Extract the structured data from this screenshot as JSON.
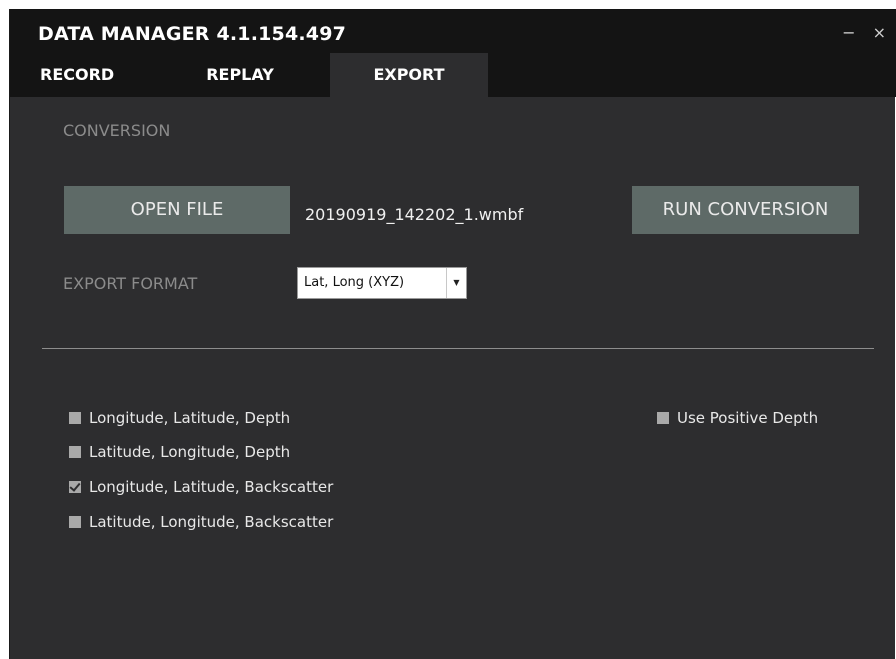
{
  "window": {
    "title": "DATA MANAGER  4.1.154.497",
    "minimize_glyph": "−",
    "close_glyph": "×"
  },
  "tabs": [
    {
      "label": "RECORD",
      "active": false
    },
    {
      "label": "REPLAY",
      "active": false
    },
    {
      "label": "EXPORT",
      "active": true
    }
  ],
  "conversion": {
    "section_title": "CONVERSION",
    "open_file_label": "OPEN FILE",
    "file_name": "20190919_142202_1.wmbf",
    "run_conversion_label": "RUN CONVERSION"
  },
  "export_format": {
    "label": "EXPORT FORMAT",
    "selected": "Lat, Long (XYZ)",
    "arrow_glyph": "▼"
  },
  "options": [
    {
      "label": "Longitude, Latitude, Depth",
      "checked": false
    },
    {
      "label": "Latitude, Longitude, Depth",
      "checked": false
    },
    {
      "label": "Longitude, Latitude, Backscatter",
      "checked": true
    },
    {
      "label": "Latitude, Longitude, Backscatter",
      "checked": false
    }
  ],
  "use_positive_depth": {
    "label": "Use Positive Depth",
    "checked": false
  },
  "colors": {
    "titlebar_bg": "#141414",
    "panel_bg": "#2d2d2f",
    "button_bg": "#5e6a67",
    "muted_text": "#8b8b8b"
  }
}
